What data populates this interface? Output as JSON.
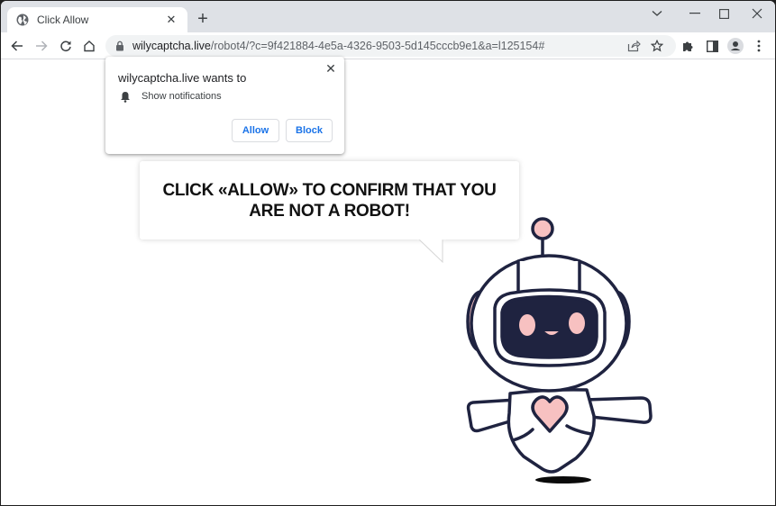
{
  "browser": {
    "tab": {
      "title": "Click Allow",
      "favicon": "globe-icon"
    },
    "new_tab_label": "+",
    "window_controls": [
      "tab-search",
      "minimize",
      "maximize",
      "close"
    ],
    "address": {
      "host": "wilycaptcha.live",
      "path": "/robot4/?c=9f421884-4e5a-4326-9503-5d145cccb9e1&a=l125154#"
    }
  },
  "permission_popup": {
    "title": "wilycaptcha.live wants to",
    "permission": "Show notifications",
    "allow_label": "Allow",
    "block_label": "Block",
    "close_glyph": "✕"
  },
  "page": {
    "message": "CLICK «ALLOW» TO CONFIRM THAT YOU ARE NOT A ROBOT!"
  },
  "colors": {
    "accent": "#1a73e8",
    "robot_outline": "#1f2340",
    "robot_pink": "#f7c1c1"
  }
}
